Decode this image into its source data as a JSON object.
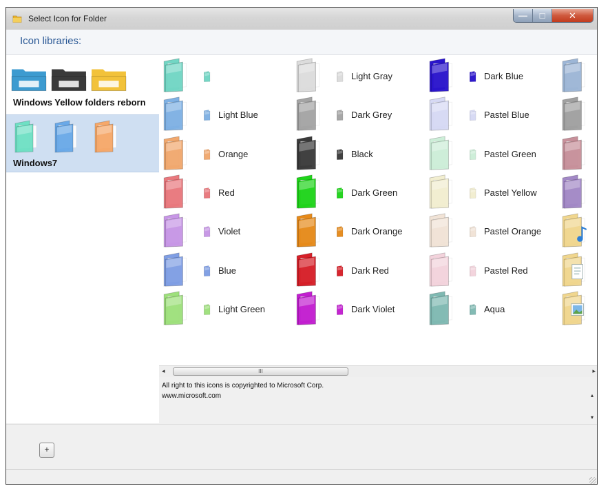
{
  "window": {
    "title": "Select Icon for Folder",
    "caption_buttons": {
      "minimize": "—",
      "maximize": "□",
      "close": "✕"
    }
  },
  "libraries_header": "Icon libraries:",
  "libraries": [
    {
      "name": "Windows Yellow folders reborn",
      "selected": false,
      "preview_colors": [
        "#3d9bd0",
        "#3a3a3a",
        "#f2c23a"
      ]
    },
    {
      "name": "Windows7",
      "selected": true,
      "preview_colors": [
        "#6fe0c4",
        "#6aa9e8",
        "#f6a86a"
      ]
    }
  ],
  "icon_columns": [
    [
      {
        "label": "",
        "color": "#72d6c4"
      },
      {
        "label": "Light Blue",
        "color": "#7fb1e4"
      },
      {
        "label": "Orange",
        "color": "#f1a86e"
      },
      {
        "label": "Red",
        "color": "#e9787d"
      },
      {
        "label": "Violet",
        "color": "#c796e6"
      },
      {
        "label": "Blue",
        "color": "#7f9ee4"
      },
      {
        "label": "Light Green",
        "color": "#9ee07c"
      }
    ],
    [
      {
        "label": "Light Gray",
        "color": "#dcdcdc"
      },
      {
        "label": "Dark Grey",
        "color": "#a4a4a4"
      },
      {
        "label": "Black",
        "color": "#3b3b3b"
      },
      {
        "label": "Dark Green",
        "color": "#1fd41a"
      },
      {
        "label": "Dark Orange",
        "color": "#e68a1a"
      },
      {
        "label": "Dark Red",
        "color": "#d61f28"
      },
      {
        "label": "Dark Violet",
        "color": "#c21ed0"
      }
    ],
    [
      {
        "label": "Dark Blue",
        "color": "#2a14cc"
      },
      {
        "label": "Pastel Blue",
        "color": "#d6d9f4"
      },
      {
        "label": "Pastel Green",
        "color": "#cdeed8"
      },
      {
        "label": "Pastel Yellow",
        "color": "#f2eed0"
      },
      {
        "label": "Pastel Orange",
        "color": "#f1e3d6"
      },
      {
        "label": "Pastel Red",
        "color": "#f3d3dc"
      },
      {
        "label": "Aqua",
        "color": "#7fb9b2"
      }
    ],
    [
      {
        "label": "",
        "color": "#9db6d6"
      },
      {
        "label": "",
        "color": "#a0a0a0"
      },
      {
        "label": "",
        "color": "#c7909a"
      },
      {
        "label": "",
        "color": "#a288c6"
      },
      {
        "label": "",
        "color": "#f0d68e",
        "overlay": "music"
      },
      {
        "label": "",
        "color": "#f0d68e",
        "overlay": "document"
      },
      {
        "label": "",
        "color": "#f0d68e",
        "overlay": "picture"
      }
    ]
  ],
  "scrollbar": {
    "left_arrow": "◂",
    "right_arrow": "▸",
    "thumb_grip": "III",
    "up_arrow": "▴",
    "down_arrow": "▾"
  },
  "copyright": {
    "line1": "All right to this icons is copyrighted to Microsoft Corp.",
    "line2": "www.microsoft.com"
  },
  "add_button": "+"
}
